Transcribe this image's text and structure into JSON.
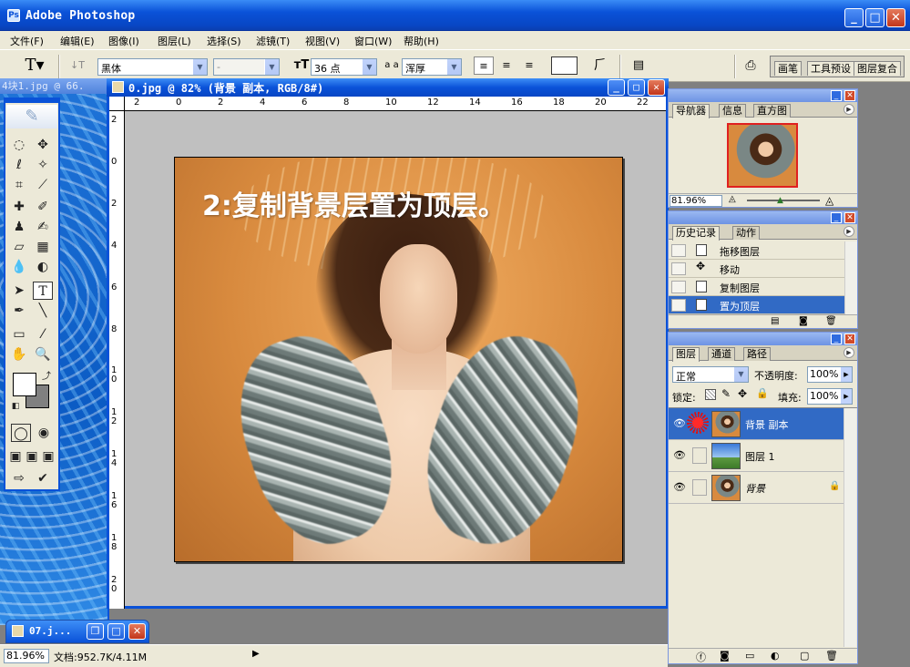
{
  "app": {
    "title": "Adobe Photoshop"
  },
  "menu": [
    "文件(F)",
    "编辑(E)",
    "图像(I)",
    "图层(L)",
    "选择(S)",
    "滤镜(T)",
    "视图(V)",
    "窗口(W)",
    "帮助(H)"
  ],
  "options": {
    "font_family": "黑体",
    "font_style": "-",
    "font_size": "36 点",
    "antialias_prefix": "a a",
    "antialias": "浑厚"
  },
  "palette_well": [
    "画笔",
    "工具预设",
    "图层复合"
  ],
  "background_doc": {
    "title": "4块1.jpg @ 66."
  },
  "document": {
    "title": "0.jpg @ 82% (背景 副本, RGB/8#)",
    "caption": "2:复制背景层置为顶层。",
    "ruler_h": [
      "2",
      "0",
      "2",
      "4",
      "6",
      "8",
      "10",
      "12",
      "14",
      "16",
      "18",
      "20",
      "22"
    ],
    "ruler_v": [
      "2",
      "0",
      "2",
      "4",
      "6",
      "8",
      "1 0",
      "1 2",
      "1 4",
      "1 6",
      "1 8",
      "2 0"
    ]
  },
  "navigator": {
    "tabs": [
      "导航器",
      "信息",
      "直方图"
    ],
    "zoom": "81.96%"
  },
  "history": {
    "tabs": [
      "历史记录",
      "动作"
    ],
    "items": [
      "拖移图层",
      "移动",
      "复制图层",
      "置为顶层"
    ]
  },
  "layers": {
    "tabs": [
      "图层",
      "通道",
      "路径"
    ],
    "blend_mode": "正常",
    "opacity_label": "不透明度:",
    "opacity": "100%",
    "lock_label": "锁定:",
    "fill_label": "填充:",
    "fill": "100%",
    "items": [
      "背景 副本",
      "图层 1",
      "背景"
    ]
  },
  "minimized_doc": {
    "title": "07.j..."
  },
  "status": {
    "zoom": "81.96%",
    "doc_info": "文档:952.7K/4.11M"
  },
  "colors": {
    "xp_blue": "#0a52d8",
    "panel_bg": "#ece9d8",
    "selection": "#316ac5"
  }
}
